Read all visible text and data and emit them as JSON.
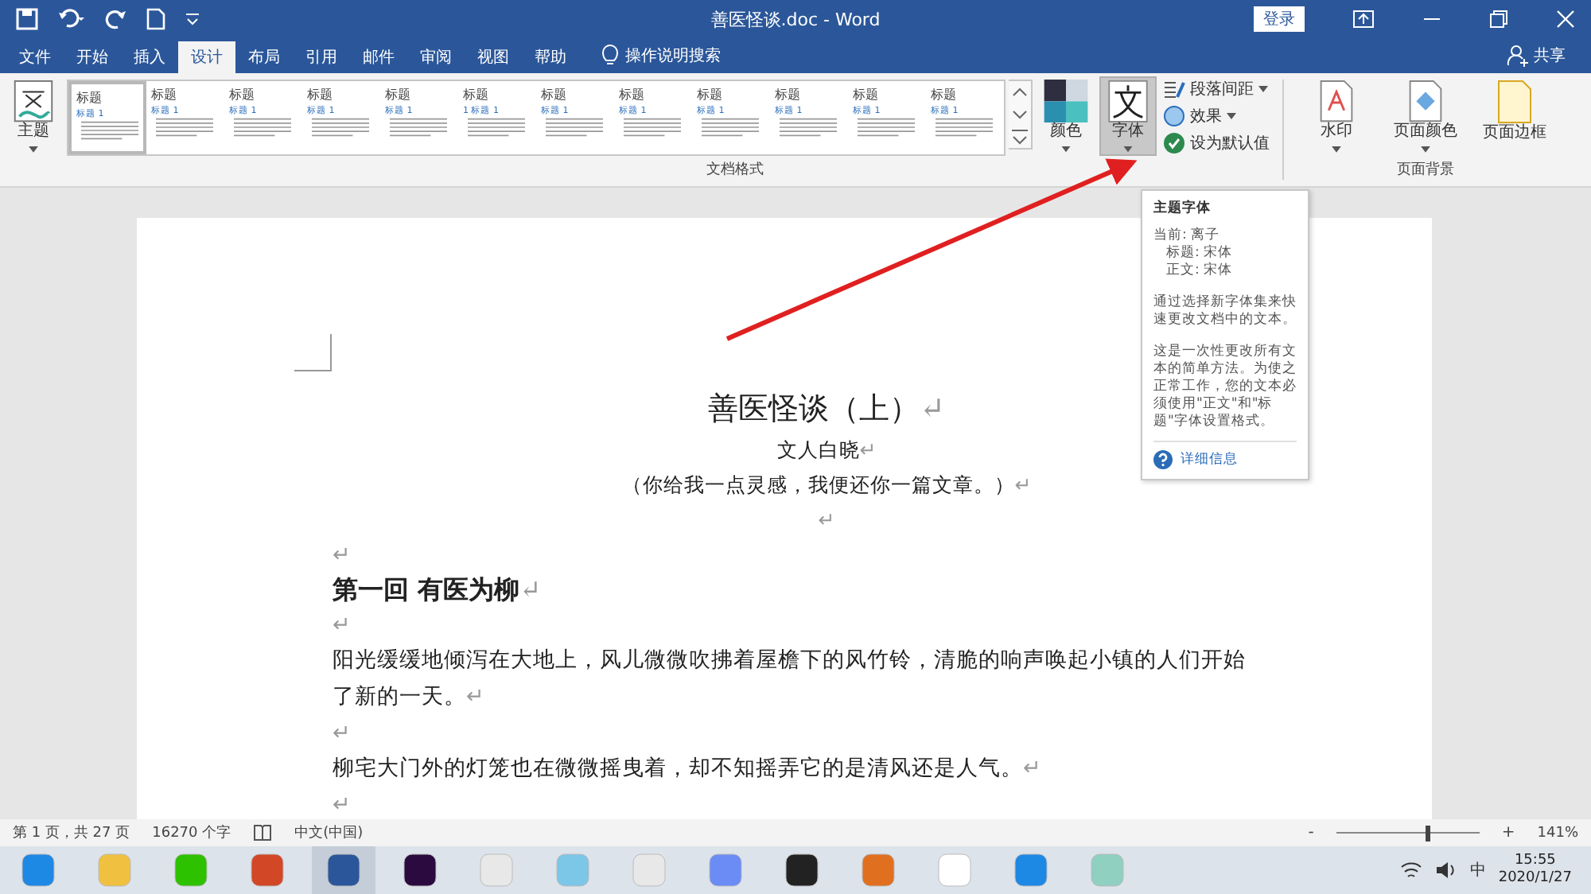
{
  "window": {
    "title": "善医怪谈.doc  -  Word",
    "sign_in": "登录"
  },
  "tabs": [
    {
      "label": "文件",
      "selected": false
    },
    {
      "label": "开始",
      "selected": false
    },
    {
      "label": "插入",
      "selected": false
    },
    {
      "label": "设计",
      "selected": true
    },
    {
      "label": "布局",
      "selected": false
    },
    {
      "label": "引用",
      "selected": false
    },
    {
      "label": "邮件",
      "selected": false
    },
    {
      "label": "审阅",
      "selected": false
    },
    {
      "label": "视图",
      "selected": false
    },
    {
      "label": "帮助",
      "selected": false
    }
  ],
  "tell_me": "操作说明搜索",
  "share": "共享",
  "ribbon": {
    "theme": "主题",
    "gallery": [
      {
        "title": "标题",
        "heading": "标题 1",
        "selected": true
      },
      {
        "title": "标题",
        "heading": "标题 1",
        "selected": false
      },
      {
        "title": "标题",
        "heading": "标题 1",
        "selected": false
      },
      {
        "title": "标题",
        "heading": "标题 1",
        "selected": false
      },
      {
        "title": "标题",
        "heading": "标题 1",
        "selected": false
      },
      {
        "title": "标题",
        "heading": "1 标题 1",
        "selected": false
      },
      {
        "title": "标题",
        "heading": "标题 1",
        "selected": false
      },
      {
        "title": "标题",
        "heading": "标题 1",
        "selected": false
      },
      {
        "title": "标题",
        "heading": "标题 1",
        "selected": false
      },
      {
        "title": "标题",
        "heading": "标题 1",
        "selected": false
      },
      {
        "title": "标题",
        "heading": "标题 1",
        "selected": false
      },
      {
        "title": "标题",
        "heading": "标题 1",
        "selected": false
      }
    ],
    "gallery_group": "文档格式",
    "colors": "颜色",
    "fonts": {
      "label": "字体",
      "selected": true
    },
    "small_buttons": [
      "段落间距",
      "效果",
      "设为默认值"
    ],
    "background_buttons": [
      "水印",
      "页面颜色",
      "页面边框"
    ],
    "background_group": "页面背景"
  },
  "tooltip": {
    "title": "主题字体",
    "lines": [
      "当前: 离子",
      "标题: 宋体",
      "正文: 宋体"
    ],
    "paragraphs": [
      "通过选择新字体集来快速更改文档中的文本。",
      "这是一次性更改所有文本的简单方法。为使之正常工作，您的文本必须使用\"正文\"和\"标题\"字体设置格式。"
    ],
    "link": "详细信息"
  },
  "document": [
    {
      "kind": "title",
      "text": "善医怪谈（上）",
      "mark": "↵"
    },
    {
      "kind": "center",
      "text": "文人白晓",
      "mark": "↵"
    },
    {
      "kind": "center",
      "text": "（你给我一点灵感，我便还你一篇文章。）",
      "mark": "↵"
    },
    {
      "kind": "center-empty",
      "mark": "↵"
    },
    {
      "kind": "empty",
      "mark": "↵"
    },
    {
      "kind": "heading",
      "text": "第一回  有医为柳",
      "mark": "↵"
    },
    {
      "kind": "empty",
      "mark": "↵"
    },
    {
      "kind": "body",
      "text": "阳光缓缓地倾泻在大地上，风儿微微吹拂着屋檐下的风竹铃，清脆的响声唤起小镇的人们开始了新的一天。",
      "mark": "↵"
    },
    {
      "kind": "empty",
      "mark": "↵"
    },
    {
      "kind": "body",
      "text": "柳宅大门外的灯笼也在微微摇曳着，却不知摇弄它的是清风还是人气。",
      "mark": "↵"
    },
    {
      "kind": "empty",
      "mark": "↵"
    }
  ],
  "status_bar": {
    "page": "第 1 页，共 27 页",
    "words": "16270 个字",
    "language": "中文(中国)",
    "zoom": "141%",
    "zoom_out": "-",
    "zoom_in": "+",
    "level": 0.62
  },
  "taskbar": {
    "ime": "中",
    "time": "15:55",
    "date": "2020/1/27"
  }
}
